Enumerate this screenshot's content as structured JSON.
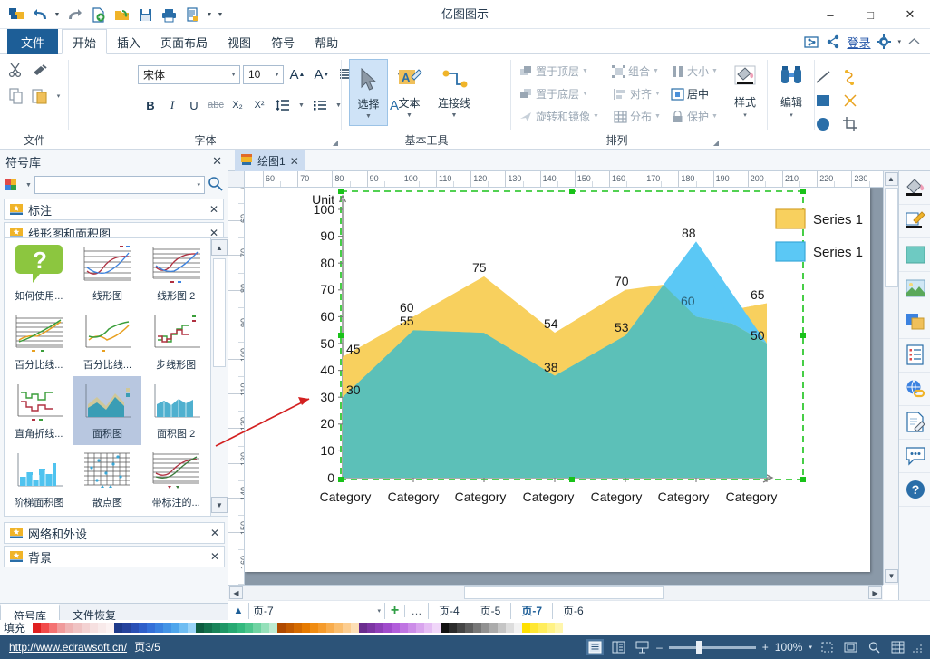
{
  "window": {
    "title": "亿图图示",
    "minimize": "–",
    "maximize": "□",
    "close": "✕"
  },
  "quick_access": {
    "icons": [
      "edraw-logo-icon",
      "undo-icon",
      "undo-dropdown-caret",
      "redo-icon",
      "new-icon",
      "open-icon",
      "save-icon",
      "print-icon",
      "print-preview-icon",
      "print-dropdown-caret",
      "qat-customize-caret"
    ]
  },
  "ribbon_tabs": {
    "file": "文件",
    "items": [
      {
        "label": "开始",
        "active": true
      },
      {
        "label": "插入",
        "active": false
      },
      {
        "label": "页面布局",
        "active": false
      },
      {
        "label": "视图",
        "active": false
      },
      {
        "label": "符号",
        "active": false
      },
      {
        "label": "帮助",
        "active": false
      }
    ],
    "right": {
      "share_export_icon": "export-icon",
      "share_icon": "share-icon",
      "login": "登录",
      "settings_icon": "gear-icon",
      "settings_caret": "▾",
      "collapse_icon": "collapse-ribbon-icon"
    }
  },
  "ribbon": {
    "clipboard": {
      "label": "文件",
      "cut": "cut-icon",
      "format_painter": "format-painter-icon",
      "copy": "copy-icon",
      "paste": "paste-icon",
      "paste_caret": "▾"
    },
    "font": {
      "label": "字体",
      "font_family": "宋体",
      "font_size": "10",
      "grow_font": "A",
      "shrink_font": "A",
      "align_icon": "align-icon",
      "text_curve_icon": "text-curve-icon",
      "bold": "B",
      "italic": "I",
      "underline": "U",
      "strikethrough": "abc",
      "subscript": "X₂",
      "superscript": "X²",
      "line_spacing_icon": "line-spacing-icon",
      "bullets_icon": "bullet-list-icon",
      "highlight_icon": "text-highlight-icon",
      "font_color": "A",
      "dialog_launcher": "◢"
    },
    "basic_tools": {
      "label": "基本工具",
      "select": "选择",
      "text": "文本",
      "connector": "连接线",
      "shapes": [
        "line-tool-icon",
        "curve-tool-icon",
        "rectangle-tool-icon",
        "x-connector-icon",
        "ellipse-tool-icon",
        "crop-tool-icon"
      ]
    },
    "arrange": {
      "label": "排列",
      "bring_to_front": "置于顶层",
      "send_to_back": "置于底层",
      "rotate_flip": "旋转和镜像",
      "group": "组合",
      "align": "对齐",
      "distribute": "分布",
      "size": "大小",
      "center": "居中",
      "protect": "保护",
      "dialog_launcher": "◢"
    },
    "style": {
      "label": "样式",
      "icon": "fill-style-icon",
      "caret": "▾"
    },
    "edit": {
      "label": "编辑",
      "icon": "find-binoculars-icon",
      "caret": "▾"
    }
  },
  "library_panel": {
    "title": "符号库",
    "close": "✕",
    "search_placeholder": "",
    "search_caret": "▾",
    "search_icon": "search-icon",
    "cube_icon": "library-cube-icon",
    "categories": [
      {
        "label": "标注",
        "expanded": false
      },
      {
        "label": "线形图和面积图",
        "expanded": true
      },
      {
        "label": "网络和外设",
        "expanded": false
      },
      {
        "label": "背景",
        "expanded": false
      }
    ],
    "symbols": [
      {
        "caption": "如何使用...",
        "icon": "help-bubble-thumb",
        "selected": false
      },
      {
        "caption": "线形图",
        "icon": "line-chart-thumb",
        "selected": false
      },
      {
        "caption": "线形图 2",
        "icon": "line-chart-2-thumb",
        "selected": false
      },
      {
        "caption": "百分比线...",
        "icon": "percent-line-thumb",
        "selected": false
      },
      {
        "caption": "百分比线...",
        "icon": "percent-line-2-thumb",
        "selected": false
      },
      {
        "caption": "步线形图",
        "icon": "step-line-thumb",
        "selected": false
      },
      {
        "caption": "直角折线...",
        "icon": "right-angle-line-thumb",
        "selected": false
      },
      {
        "caption": "面积图",
        "icon": "area-chart-thumb",
        "selected": true
      },
      {
        "caption": "面积图 2",
        "icon": "area-chart-2-thumb",
        "selected": false
      },
      {
        "caption": "阶梯面积图",
        "icon": "step-area-thumb",
        "selected": false
      },
      {
        "caption": "散点图",
        "icon": "scatter-thumb",
        "selected": false
      },
      {
        "caption": "带标注的...",
        "icon": "annotated-line-thumb",
        "selected": false
      }
    ],
    "scroll_up": "▲",
    "scroll_down": "▼",
    "bottom_tabs": [
      {
        "label": "符号库",
        "active": true
      },
      {
        "label": "文件恢复",
        "active": false
      }
    ]
  },
  "document": {
    "tab_label": "绘图1",
    "tab_close": "✕",
    "tab_icon": "document-icon"
  },
  "rulers": {
    "horizontal": [
      60,
      70,
      80,
      90,
      100,
      110,
      120,
      130,
      140,
      150,
      160,
      170,
      180,
      190,
      200,
      210,
      220,
      230
    ],
    "vertical": [
      50,
      60,
      70,
      80,
      90,
      100,
      110,
      120,
      130,
      140,
      150,
      160
    ]
  },
  "chart_data": {
    "type": "area",
    "title": "",
    "ylabel": "Unit",
    "xlabel": "",
    "categories": [
      "Category",
      "Category",
      "Category",
      "Category",
      "Category",
      "Category",
      "Category"
    ],
    "ylim": [
      0,
      100
    ],
    "yticks": [
      0,
      10,
      20,
      30,
      40,
      50,
      60,
      70,
      80,
      90,
      100
    ],
    "grid": false,
    "legend_position": "right",
    "series": [
      {
        "name": "Series 1",
        "color": "#F8D05E",
        "values": [
          45,
          60,
          75,
          54,
          70,
          60,
          65
        ],
        "labels": [
          "45",
          "60",
          "75",
          "54",
          "70",
          "",
          "65"
        ]
      },
      {
        "name": "Series 1",
        "color": "#5BC8F5",
        "values": [
          30,
          55,
          54,
          38,
          53,
          88,
          50
        ],
        "labels": [
          "30",
          "55",
          "54",
          "38",
          "53",
          "88",
          "50"
        ]
      }
    ],
    "overlap_color": "#5CC0B8",
    "inner_label_60": "60",
    "selection_handles": true,
    "selection_color": "#19c219"
  },
  "annotation": {
    "arrow_color": "#d32020",
    "arrow_from_symbol": "面积图",
    "arrow_to_chart": true
  },
  "right_rail": {
    "icons": [
      "fill-style-icon",
      "line-style-icon",
      "theme-color-icon",
      "image-icon",
      "layer-icon",
      "properties-icon",
      "hyperlink-icon",
      "note-icon",
      "comment-icon",
      "help-icon"
    ]
  },
  "page_tabs": {
    "collapse_icon": "▲",
    "current_page": "页-7",
    "combo_caret": "▾",
    "add": "+",
    "more": "…",
    "tabs": [
      {
        "label": "页-4",
        "active": false
      },
      {
        "label": "页-5",
        "active": false
      },
      {
        "label": "页-7",
        "active": true
      },
      {
        "label": "页-6",
        "active": false
      }
    ]
  },
  "palette": {
    "label": "填充",
    "colors": [
      "#e02020",
      "#f24a4a",
      "#f47272",
      "#f09a9a",
      "#efb3b3",
      "#f0c3c3",
      "#f3d2d2",
      "#f6e0e0",
      "#f8eaea",
      "#fbf2f2",
      "#1e3a8a",
      "#26439c",
      "#2b50b5",
      "#2f5fc9",
      "#3570d8",
      "#3b82e0",
      "#4494e6",
      "#4fa6ec",
      "#6fbdf2",
      "#9ad3f7",
      "#0e5c3f",
      "#14714c",
      "#1a8459",
      "#1f9766",
      "#27a972",
      "#33b97e",
      "#4cc68d",
      "#6fd3a2",
      "#95e0ba",
      "#bdead1",
      "#b04a00",
      "#c25a00",
      "#d46a00",
      "#e67a00",
      "#f08c12",
      "#f59b2c",
      "#f8ac4c",
      "#fabd6d",
      "#fccd90",
      "#fddfb5",
      "#6b2d8f",
      "#7c35a3",
      "#8e3fb8",
      "#a04bcc",
      "#b15ddb",
      "#bf74e2",
      "#cc8ce8",
      "#d9a4ee",
      "#e5bdf4",
      "#f0d6f9",
      "#111111",
      "#2b2b2b",
      "#444444",
      "#5d5d5d",
      "#777777",
      "#919191",
      "#ababab",
      "#c5c5c5",
      "#dddddd",
      "#f2f2f2",
      "#ffe000",
      "#ffe733",
      "#ffed5c",
      "#fff285",
      "#fff6ad"
    ]
  },
  "status_bar": {
    "website": "http://www.edrawsoft.cn/",
    "page_count": "页3/5",
    "view_buttons": [
      "single-page-view-icon",
      "two-page-view-icon",
      "fit-page-view-icon"
    ],
    "zoom_out": "–",
    "zoom_in": "+",
    "zoom_level": "100%",
    "zoom_caret": "▾",
    "extra_buttons": [
      "fit-selection-icon",
      "fit-page-icon",
      "zoom-region-icon",
      "grid-toggle-icon"
    ]
  }
}
